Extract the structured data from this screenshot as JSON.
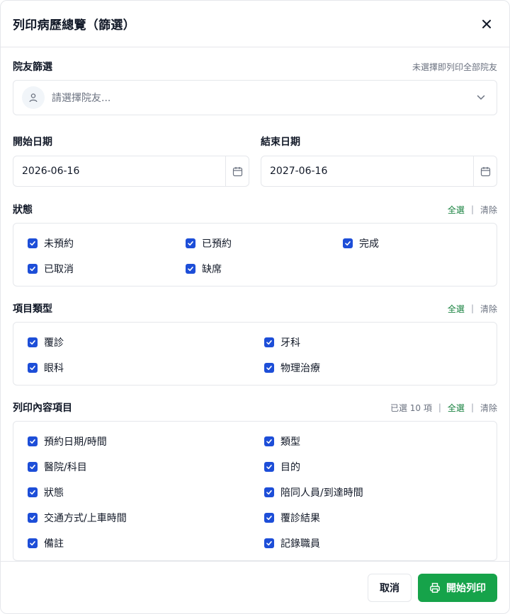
{
  "dialog": {
    "title": "列印病歷總覽（篩選）"
  },
  "resident": {
    "label": "院友篩選",
    "hint": "未選擇即列印全部院友",
    "placeholder": "請選擇院友..."
  },
  "dates": {
    "start_label": "開始日期",
    "start_value": "2026-06-16",
    "end_label": "結束日期",
    "end_value": "2027-06-16"
  },
  "status": {
    "label": "狀態",
    "select_all": "全選",
    "clear": "清除",
    "items": [
      "未預約",
      "已預約",
      "完成",
      "已取消",
      "缺席"
    ]
  },
  "types": {
    "label": "項目類型",
    "select_all": "全選",
    "clear": "清除",
    "items": [
      "覆診",
      "牙科",
      "眼科",
      "物理治療"
    ]
  },
  "fields": {
    "label": "列印內容項目",
    "count": "已選 10 項",
    "select_all": "全選",
    "clear": "清除",
    "items": [
      "預約日期/時間",
      "類型",
      "醫院/科目",
      "目的",
      "狀態",
      "陪同人員/到達時間",
      "交通方式/上車時間",
      "覆診結果",
      "備註",
      "記錄職員"
    ]
  },
  "footer": {
    "cancel": "取消",
    "print": "開始列印"
  },
  "colors": {
    "accent_green": "#16a34a",
    "checkbox": "#1d4ed8"
  }
}
